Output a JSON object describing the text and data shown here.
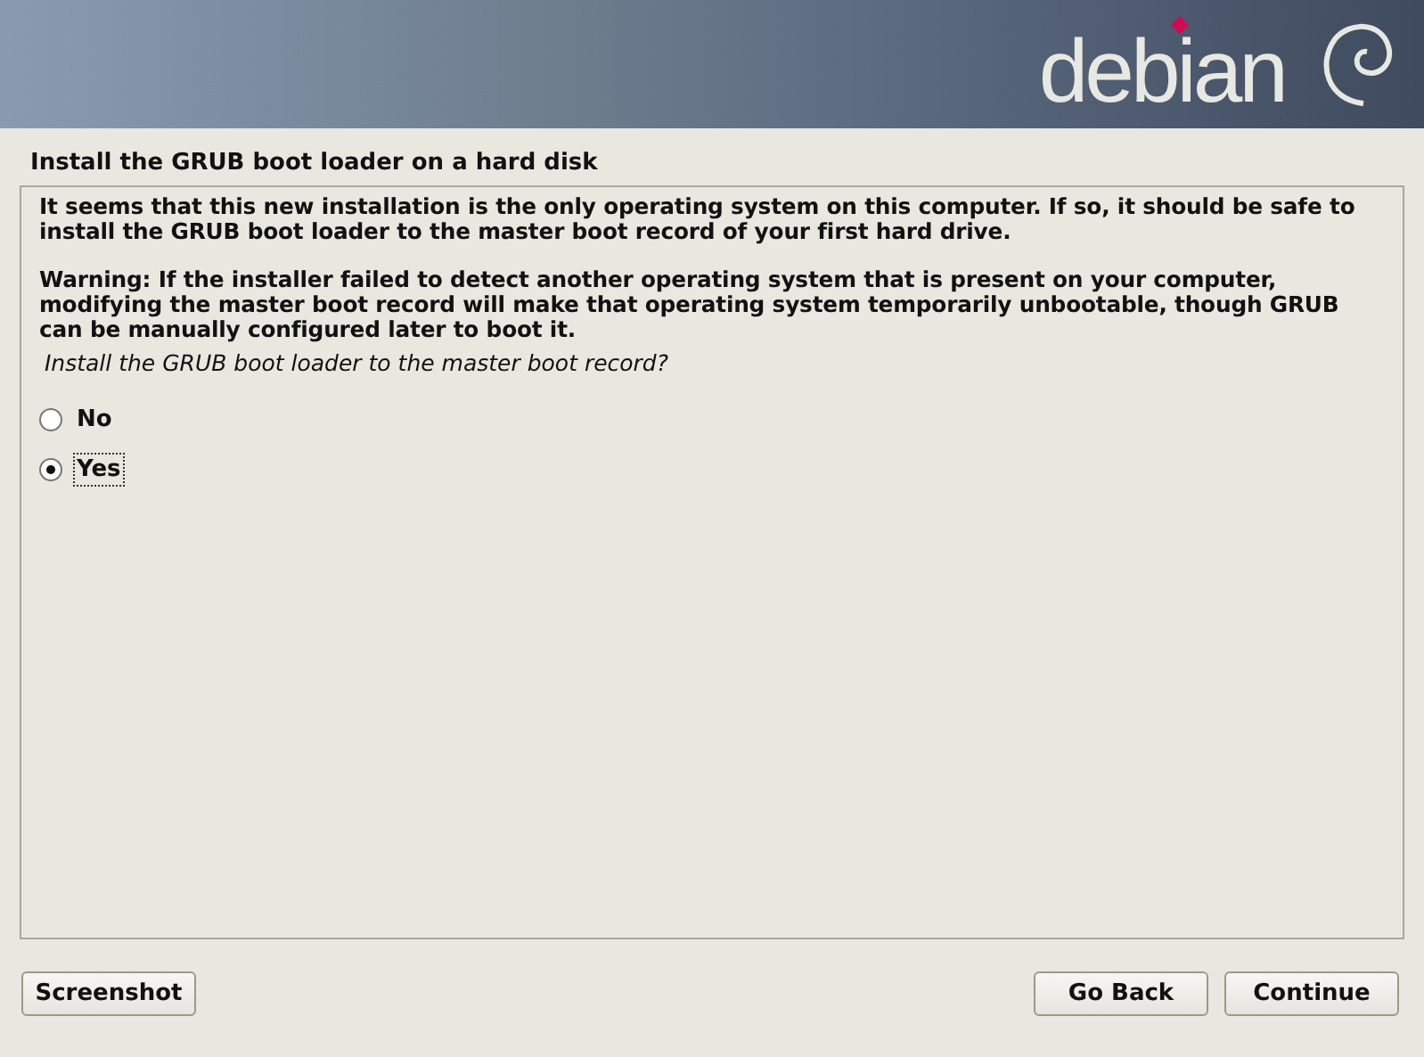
{
  "banner": {
    "logo_text": "debian"
  },
  "title": "Install the GRUB boot loader on a hard disk",
  "paragraphs": [
    "It seems that this new installation is the only operating system on this computer. If so, it should be safe to install the GRUB boot loader to the master boot record of your first hard drive.",
    "Warning: If the installer failed to detect another operating system that is present on your computer, modifying the master boot record will make that operating system temporarily unbootable, though GRUB can be manually configured later to boot it."
  ],
  "question": "Install the GRUB boot loader to the master boot record?",
  "options": [
    {
      "label": "No",
      "selected": false
    },
    {
      "label": "Yes",
      "selected": true
    }
  ],
  "buttons": {
    "left": [
      "Screenshot"
    ],
    "right": [
      "Go Back",
      "Continue"
    ]
  }
}
